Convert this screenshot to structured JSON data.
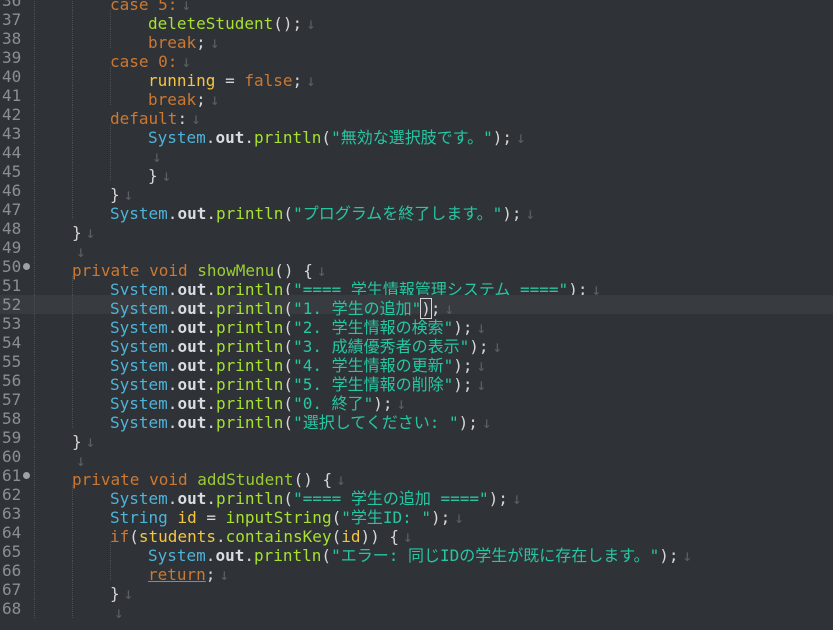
{
  "editor": {
    "eol_mark": "↓",
    "lines": [
      {
        "num": "36",
        "indent": 2,
        "tokens": [
          {
            "c": "tok-case",
            "t": "case 5:"
          }
        ]
      },
      {
        "num": "37",
        "indent": 3,
        "tokens": [
          {
            "c": "tok-methodcall",
            "t": "deleteStudent"
          },
          {
            "c": "tok-plain",
            "t": "();"
          }
        ]
      },
      {
        "num": "38",
        "indent": 3,
        "tokens": [
          {
            "c": "tok-kw",
            "t": "break"
          },
          {
            "c": "tok-plain",
            "t": ";"
          }
        ]
      },
      {
        "num": "39",
        "indent": 2,
        "tokens": [
          {
            "c": "tok-case",
            "t": "case 0:"
          }
        ]
      },
      {
        "num": "40",
        "indent": 3,
        "tokens": [
          {
            "c": "tok-var",
            "t": "running"
          },
          {
            "c": "tok-plain",
            "t": " = "
          },
          {
            "c": "tok-kw",
            "t": "false"
          },
          {
            "c": "tok-plain",
            "t": ";"
          }
        ]
      },
      {
        "num": "41",
        "indent": 3,
        "tokens": [
          {
            "c": "tok-kw",
            "t": "break"
          },
          {
            "c": "tok-plain",
            "t": ";"
          }
        ]
      },
      {
        "num": "42",
        "indent": 2,
        "tokens": [
          {
            "c": "tok-kw",
            "t": "default"
          },
          {
            "c": "tok-plain",
            "t": ":"
          }
        ]
      },
      {
        "num": "43",
        "indent": 3,
        "tokens": [
          {
            "c": "tok-class",
            "t": "System"
          },
          {
            "c": "tok-plain",
            "t": "."
          },
          {
            "c": "tok-field",
            "t": "out"
          },
          {
            "c": "tok-plain",
            "t": "."
          },
          {
            "c": "tok-methodcall",
            "t": "println"
          },
          {
            "c": "tok-plain",
            "t": "("
          },
          {
            "c": "tok-string",
            "t": "\"無効な選択肢です。\""
          },
          {
            "c": "tok-plain",
            "t": ");"
          }
        ]
      },
      {
        "num": "44",
        "indent": 3,
        "tokens": []
      },
      {
        "num": "45",
        "indent": 3,
        "tokens": [
          {
            "c": "tok-plain",
            "t": "}"
          }
        ]
      },
      {
        "num": "46",
        "indent": 2,
        "tokens": [
          {
            "c": "tok-plain",
            "t": "}"
          }
        ]
      },
      {
        "num": "47",
        "indent": 2,
        "tokens": [
          {
            "c": "tok-class",
            "t": "System"
          },
          {
            "c": "tok-plain",
            "t": "."
          },
          {
            "c": "tok-field",
            "t": "out"
          },
          {
            "c": "tok-plain",
            "t": "."
          },
          {
            "c": "tok-methodcall",
            "t": "println"
          },
          {
            "c": "tok-plain",
            "t": "("
          },
          {
            "c": "tok-string",
            "t": "\"プログラムを終了します。\""
          },
          {
            "c": "tok-plain",
            "t": ");"
          }
        ]
      },
      {
        "num": "48",
        "indent": 1,
        "tokens": [
          {
            "c": "tok-plain",
            "t": "}"
          }
        ]
      },
      {
        "num": "49",
        "indent": 1,
        "tokens": []
      },
      {
        "num": "50",
        "indent": 1,
        "fold": true,
        "tokens": [
          {
            "c": "tok-kw",
            "t": "private void "
          },
          {
            "c": "tok-method",
            "t": "showMenu"
          },
          {
            "c": "tok-plain",
            "t": "() {"
          }
        ]
      },
      {
        "num": "51",
        "indent": 2,
        "tokens": [
          {
            "c": "tok-class",
            "t": "System"
          },
          {
            "c": "tok-plain",
            "t": "."
          },
          {
            "c": "tok-field",
            "t": "out"
          },
          {
            "c": "tok-plain",
            "t": "."
          },
          {
            "c": "tok-methodcall",
            "t": "println"
          },
          {
            "c": "tok-plain",
            "t": "("
          },
          {
            "c": "tok-string",
            "t": "\"==== 学生情報管理システム ====\""
          },
          {
            "c": "tok-plain",
            "t": ");"
          }
        ]
      },
      {
        "num": "52",
        "indent": 2,
        "current": true,
        "tokens": [
          {
            "c": "tok-class",
            "t": "System"
          },
          {
            "c": "tok-plain",
            "t": "."
          },
          {
            "c": "tok-field",
            "t": "out"
          },
          {
            "c": "tok-plain",
            "t": "."
          },
          {
            "c": "tok-methodcall",
            "t": "println"
          },
          {
            "c": "tok-plain",
            "t": "("
          },
          {
            "c": "tok-string",
            "t": "\"1. 学生の追加\""
          },
          {
            "c": "tok-plain cursor-box",
            "t": ")"
          },
          {
            "c": "tok-plain",
            "t": ";"
          }
        ]
      },
      {
        "num": "53",
        "indent": 2,
        "tokens": [
          {
            "c": "tok-class",
            "t": "System"
          },
          {
            "c": "tok-plain",
            "t": "."
          },
          {
            "c": "tok-field",
            "t": "out"
          },
          {
            "c": "tok-plain",
            "t": "."
          },
          {
            "c": "tok-methodcall",
            "t": "println"
          },
          {
            "c": "tok-plain",
            "t": "("
          },
          {
            "c": "tok-string",
            "t": "\"2. 学生情報の検索\""
          },
          {
            "c": "tok-plain",
            "t": ");"
          }
        ]
      },
      {
        "num": "54",
        "indent": 2,
        "tokens": [
          {
            "c": "tok-class",
            "t": "System"
          },
          {
            "c": "tok-plain",
            "t": "."
          },
          {
            "c": "tok-field",
            "t": "out"
          },
          {
            "c": "tok-plain",
            "t": "."
          },
          {
            "c": "tok-methodcall",
            "t": "println"
          },
          {
            "c": "tok-plain",
            "t": "("
          },
          {
            "c": "tok-string",
            "t": "\"3. 成績優秀者の表示\""
          },
          {
            "c": "tok-plain",
            "t": ");"
          }
        ]
      },
      {
        "num": "55",
        "indent": 2,
        "tokens": [
          {
            "c": "tok-class",
            "t": "System"
          },
          {
            "c": "tok-plain",
            "t": "."
          },
          {
            "c": "tok-field",
            "t": "out"
          },
          {
            "c": "tok-plain",
            "t": "."
          },
          {
            "c": "tok-methodcall",
            "t": "println"
          },
          {
            "c": "tok-plain",
            "t": "("
          },
          {
            "c": "tok-string",
            "t": "\"4. 学生情報の更新\""
          },
          {
            "c": "tok-plain",
            "t": ");"
          }
        ]
      },
      {
        "num": "56",
        "indent": 2,
        "tokens": [
          {
            "c": "tok-class",
            "t": "System"
          },
          {
            "c": "tok-plain",
            "t": "."
          },
          {
            "c": "tok-field",
            "t": "out"
          },
          {
            "c": "tok-plain",
            "t": "."
          },
          {
            "c": "tok-methodcall",
            "t": "println"
          },
          {
            "c": "tok-plain",
            "t": "("
          },
          {
            "c": "tok-string",
            "t": "\"5. 学生情報の削除\""
          },
          {
            "c": "tok-plain",
            "t": ");"
          }
        ]
      },
      {
        "num": "57",
        "indent": 2,
        "tokens": [
          {
            "c": "tok-class",
            "t": "System"
          },
          {
            "c": "tok-plain",
            "t": "."
          },
          {
            "c": "tok-field",
            "t": "out"
          },
          {
            "c": "tok-plain",
            "t": "."
          },
          {
            "c": "tok-methodcall",
            "t": "println"
          },
          {
            "c": "tok-plain",
            "t": "("
          },
          {
            "c": "tok-string",
            "t": "\"0. 終了\""
          },
          {
            "c": "tok-plain",
            "t": ");"
          }
        ]
      },
      {
        "num": "58",
        "indent": 2,
        "tokens": [
          {
            "c": "tok-class",
            "t": "System"
          },
          {
            "c": "tok-plain",
            "t": "."
          },
          {
            "c": "tok-field",
            "t": "out"
          },
          {
            "c": "tok-plain",
            "t": "."
          },
          {
            "c": "tok-methodcall",
            "t": "println"
          },
          {
            "c": "tok-plain",
            "t": "("
          },
          {
            "c": "tok-string",
            "t": "\"選択してください: \""
          },
          {
            "c": "tok-plain",
            "t": ");"
          }
        ]
      },
      {
        "num": "59",
        "indent": 1,
        "tokens": [
          {
            "c": "tok-plain",
            "t": "}"
          }
        ]
      },
      {
        "num": "60",
        "indent": 1,
        "tokens": []
      },
      {
        "num": "61",
        "indent": 1,
        "fold": true,
        "tokens": [
          {
            "c": "tok-kw",
            "t": "private void "
          },
          {
            "c": "tok-method",
            "t": "addStudent"
          },
          {
            "c": "tok-plain",
            "t": "() {"
          }
        ]
      },
      {
        "num": "62",
        "indent": 2,
        "tokens": [
          {
            "c": "tok-class",
            "t": "System"
          },
          {
            "c": "tok-plain",
            "t": "."
          },
          {
            "c": "tok-field",
            "t": "out"
          },
          {
            "c": "tok-plain",
            "t": "."
          },
          {
            "c": "tok-methodcall",
            "t": "println"
          },
          {
            "c": "tok-plain",
            "t": "("
          },
          {
            "c": "tok-string",
            "t": "\"==== 学生の追加 ====\""
          },
          {
            "c": "tok-plain",
            "t": ");"
          }
        ]
      },
      {
        "num": "63",
        "indent": 2,
        "tokens": [
          {
            "c": "tok-type",
            "t": "String"
          },
          {
            "c": "tok-plain",
            "t": " "
          },
          {
            "c": "tok-var",
            "t": "id"
          },
          {
            "c": "tok-plain",
            "t": " = "
          },
          {
            "c": "tok-methodcall",
            "t": "inputString"
          },
          {
            "c": "tok-plain",
            "t": "("
          },
          {
            "c": "tok-string",
            "t": "\"学生ID: \""
          },
          {
            "c": "tok-plain",
            "t": ");"
          }
        ]
      },
      {
        "num": "64",
        "indent": 2,
        "tokens": [
          {
            "c": "tok-kw",
            "t": "if"
          },
          {
            "c": "tok-plain",
            "t": "("
          },
          {
            "c": "tok-var",
            "t": "students"
          },
          {
            "c": "tok-plain",
            "t": "."
          },
          {
            "c": "tok-methodcall",
            "t": "containsKey"
          },
          {
            "c": "tok-plain",
            "t": "("
          },
          {
            "c": "tok-var",
            "t": "id"
          },
          {
            "c": "tok-plain",
            "t": ")) {"
          }
        ]
      },
      {
        "num": "65",
        "indent": 3,
        "tokens": [
          {
            "c": "tok-class",
            "t": "System"
          },
          {
            "c": "tok-plain",
            "t": "."
          },
          {
            "c": "tok-field",
            "t": "out"
          },
          {
            "c": "tok-plain",
            "t": "."
          },
          {
            "c": "tok-methodcall",
            "t": "println"
          },
          {
            "c": "tok-plain",
            "t": "("
          },
          {
            "c": "tok-string",
            "t": "\"エラー: 同じIDの学生が既に存在します。\""
          },
          {
            "c": "tok-plain",
            "t": ");"
          }
        ]
      },
      {
        "num": "66",
        "indent": 3,
        "tokens": [
          {
            "c": "tok-ret",
            "t": "return"
          },
          {
            "c": "tok-plain",
            "t": ";"
          }
        ]
      },
      {
        "num": "67",
        "indent": 2,
        "tokens": [
          {
            "c": "tok-plain",
            "t": "}"
          }
        ]
      },
      {
        "num": "68",
        "indent": 2,
        "tokens": []
      }
    ]
  }
}
